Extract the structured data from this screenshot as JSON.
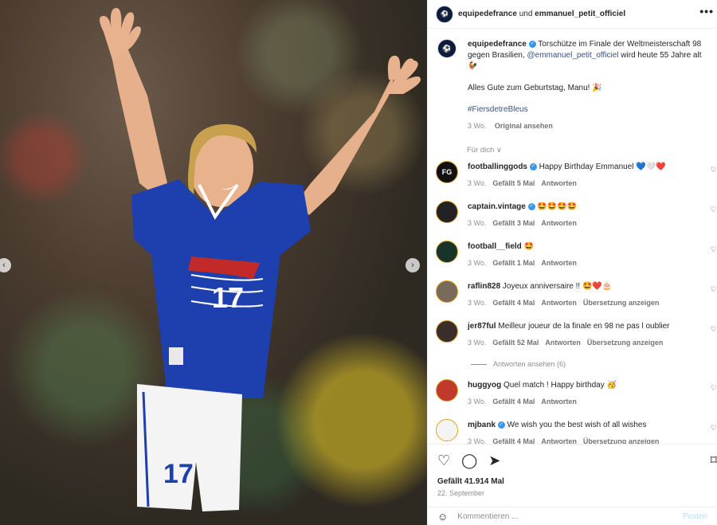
{
  "header": {
    "account": "equipedefrance",
    "und": "und",
    "collaborator": "emmanuel_petit_officiel",
    "more": "•••"
  },
  "caption": {
    "username": "equipedefrance",
    "text_1": " Torschütze im Finale der Weltmeisterschaft 98 gegen Brasilien, ",
    "mention": "@emmanuel_petit_officiel",
    "text_2": " wird heute 55 Jahre alt 🐓",
    "line2": "Alles Gute zum Geburtstag, Manu! 🎉",
    "hashtag": "#FiersdetreBleus",
    "age": "3 Wo.",
    "original": "Original ansehen"
  },
  "for_you": "Für dich ∨",
  "comments": [
    {
      "user": "footballinggods",
      "verified": true,
      "text": "Happy Birthday Emmanuel 💙🤍❤️",
      "age": "3 Wo.",
      "likes": "Gefällt 5 Mal",
      "reply": "Antworten",
      "translate": "",
      "avatar_text": "FG",
      "avatar_bg": "#111111"
    },
    {
      "user": "captain.vintage",
      "verified": true,
      "text": "🤩🤩🤩🤩",
      "age": "3 Wo.",
      "likes": "Gefällt 3 Mal",
      "reply": "Antworten",
      "translate": "",
      "avatar_text": "",
      "avatar_bg": "#222222"
    },
    {
      "user": "football__field",
      "verified": false,
      "text": "🤩",
      "age": "3 Wo.",
      "likes": "Gefällt 1 Mal",
      "reply": "Antworten",
      "translate": "",
      "avatar_text": "",
      "avatar_bg": "#17332a"
    },
    {
      "user": "raflin828",
      "verified": false,
      "text": "Joyeux anniversaire !! 🤩❤️🎂",
      "age": "3 Wo.",
      "likes": "Gefällt 4 Mal",
      "reply": "Antworten",
      "translate": "Übersetzung anzeigen",
      "avatar_text": "",
      "avatar_bg": "#7a6a5a"
    },
    {
      "user": "jer87ful",
      "verified": false,
      "text": "Meilleur joueur de la finale en 98 ne pas l oublier",
      "age": "3 Wo.",
      "likes": "Gefällt 52 Mal",
      "reply": "Antworten",
      "translate": "Übersetzung anzeigen",
      "avatar_text": "",
      "avatar_bg": "#3a2e2a"
    }
  ],
  "replies_link": "Antworten ansehen (6)",
  "comments_more": [
    {
      "user": "huggyog",
      "verified": false,
      "text": "Quel match ! Happy birthday 🥳",
      "age": "3 Wo.",
      "likes": "Gefällt 4 Mal",
      "reply": "Antworten",
      "translate": "",
      "avatar_text": "",
      "avatar_bg": "#c0392b"
    },
    {
      "user": "mjbank",
      "verified": true,
      "text": "We wish you the best wish of all wishes",
      "age": "3 Wo.",
      "likes": "Gefällt 4 Mal",
      "reply": "Antworten",
      "translate": "Übersetzung anzeigen",
      "avatar_text": "",
      "avatar_bg": "#f4f4f4"
    }
  ],
  "footer": {
    "likes": "Gefällt 41.914 Mal",
    "date": "22. September",
    "comment_placeholder": "Kommentieren ...",
    "post": "Posten"
  },
  "icons": {
    "like": "heart-icon",
    "comment": "comment-icon",
    "share": "share-icon",
    "save": "bookmark-icon",
    "emoji": "emoji-icon",
    "more": "more-icon",
    "prev": "chevron-left-icon",
    "next": "chevron-right-icon"
  },
  "colors": {
    "link": "#385185",
    "verified": "#3897f0",
    "jersey_blue": "#1e3fae"
  }
}
